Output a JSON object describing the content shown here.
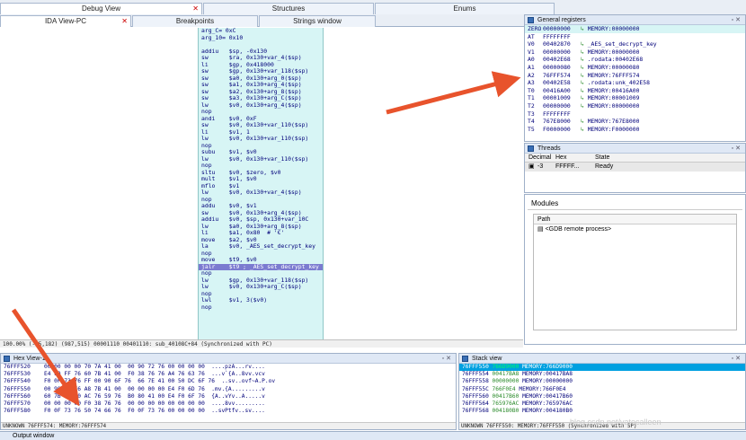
{
  "tabs": [
    {
      "label": "Debug View",
      "active": true
    },
    {
      "label": "Structures",
      "active": false
    },
    {
      "label": "Enums",
      "active": false
    },
    {
      "label": "IDA View-PC",
      "active": true
    },
    {
      "label": "Breakpoints",
      "active": false
    },
    {
      "label": "Strings window",
      "active": false
    }
  ],
  "disasm": [
    {
      "t": "arg_C= 0xC"
    },
    {
      "t": "arg_10= 0x10"
    },
    {
      "t": ""
    },
    {
      "t": "addiu   $sp, -0x130"
    },
    {
      "t": "sw      $ra, 0x130+var_4($sp)"
    },
    {
      "t": "li      $gp, 0x418000"
    },
    {
      "t": "sw      $gp, 0x130+var_118($sp)"
    },
    {
      "t": "sw      $a0, 0x130+arg_0($sp)"
    },
    {
      "t": "sw      $a1, 0x130+arg_4($sp)"
    },
    {
      "t": "sw      $a2, 0x130+arg_8($sp)"
    },
    {
      "t": "sw      $a3, 0x130+arg_C($sp)"
    },
    {
      "t": "lw      $v0, 0x130+arg_4($sp)"
    },
    {
      "t": "nop"
    },
    {
      "t": "andi    $v0, 0xF"
    },
    {
      "t": "sw      $v0, 0x130+var_110($sp)"
    },
    {
      "t": "li      $v1, 1"
    },
    {
      "t": "lw      $v0, 0x130+var_110($sp)"
    },
    {
      "t": "nop"
    },
    {
      "t": "subu    $v1, $v0"
    },
    {
      "t": "lw      $v0, 0x130+var_110($sp)"
    },
    {
      "t": "nop"
    },
    {
      "t": "sltu    $v0, $zero, $v0"
    },
    {
      "t": "mult    $v1, $v0"
    },
    {
      "t": "mflo    $v1"
    },
    {
      "t": "lw      $v0, 0x130+var_4($sp)"
    },
    {
      "t": "nop"
    },
    {
      "t": "addu    $v0, $v1"
    },
    {
      "t": "sw      $v0, 0x130+arg_4($sp)"
    },
    {
      "t": "addiu   $v0, $sp, 0x130+var_10C"
    },
    {
      "t": "lw      $a0, 0x130+arg_8($sp)"
    },
    {
      "t": "li      $a1, 0x80  # '€'"
    },
    {
      "t": "move    $a2, $v0"
    },
    {
      "t": "la      $v0, _AES_set_decrypt_key"
    },
    {
      "t": "nop"
    },
    {
      "t": "move    $t9, $v0"
    },
    {
      "t": "jalr    $t9 ; _AES_set_decrypt_key",
      "hl": true
    },
    {
      "t": "nop"
    },
    {
      "t": "lw      $gp, 0x130+var_118($sp)"
    },
    {
      "t": "lw      $v0, 0x130+arg_C($sp)"
    },
    {
      "t": "nop"
    },
    {
      "t": "lwl     $v1, 3($v0)"
    },
    {
      "t": "nop"
    }
  ],
  "status_line": "100.00% (-35,182) (987,515) 00001110 00401110: sub_40108C+84 (Synchronized with PC)",
  "registers": {
    "title": "General registers",
    "rows": [
      {
        "n": "ZERO",
        "v": "00000000",
        "c": "MEMORY:00000000",
        "sel": true
      },
      {
        "n": "AT",
        "v": "FFFFFFFF",
        "c": ""
      },
      {
        "n": "V0",
        "v": "00402870",
        "c": "_AES_set_decrypt_key"
      },
      {
        "n": "V1",
        "v": "00000000",
        "c": "MEMORY:00000000"
      },
      {
        "n": "A0",
        "v": "00402E68",
        "c": ".rodata:00402E68"
      },
      {
        "n": "A1",
        "v": "00000080",
        "c": "MEMORY:00000080"
      },
      {
        "n": "A2",
        "v": "76FFF574",
        "c": "MEMORY:76FFF574"
      },
      {
        "n": "A3",
        "v": "00402E58",
        "c": ".rodata:unk_402E58"
      },
      {
        "n": "T0",
        "v": "00416A00",
        "c": "MEMORY:00416A00"
      },
      {
        "n": "T1",
        "v": "00001009",
        "c": "MEMORY:00001009"
      },
      {
        "n": "T2",
        "v": "00000000",
        "c": "MEMORY:00000000"
      },
      {
        "n": "T3",
        "v": "FFFFFFFF",
        "c": ""
      },
      {
        "n": "T4",
        "v": "767E8000",
        "c": "MEMORY:767E8000"
      },
      {
        "n": "T5",
        "v": "F0000000",
        "c": "MEMORY:F0000000"
      }
    ]
  },
  "threads": {
    "title": "Threads",
    "columns": [
      "Decimal",
      "Hex",
      "State"
    ],
    "rows": [
      {
        "dec": "-3",
        "hex": "FFFFF...",
        "state": "Ready"
      }
    ]
  },
  "modules": {
    "title": "Modules",
    "column": "Path",
    "rows": [
      "<GDB remote process>"
    ]
  },
  "hex": {
    "title": "Hex View-1",
    "rows": [
      {
        "a": "76FFF520",
        "b": "00 00 00 00 70 7A 41 00  00 90 72 76 00 00 00 00",
        "s": "....pzA...rv...."
      },
      {
        "a": "76FFF530",
        "b": "E4 F0 FF 76 60 7B 41 00  F0 38 76 76 A4 76 63 76",
        "s": "...v`{A..8vv.vcv"
      },
      {
        "a": "76FFF540",
        "b": "F0 0F 73 76 FF 00 90 6F 76  66 7E 41 00 50 DC 6F 76",
        "s": "..sv..ovf~A.P.ov"
      },
      {
        "a": "76FFF550",
        "b": "00 90 6D 76 A8 7B 41 00  00 00 00 00 E4 F0 6D 76",
        "s": ".mv.{A.........v"
      },
      {
        "a": "76FFF560",
        "b": "60 7B 41 00 AC 76 59 76  B0 80 41 00 E4 F0 6F 76",
        "s": "{A..vYv..A.....v"
      },
      {
        "a": "76FFF570",
        "b": "00 00 00 00 F0 38 76 76  00 00 00 00 00 00 00 00",
        "s": "....8vv........."
      },
      {
        "a": "76FFF580",
        "b": "F0 0F 73 76 50 74 66 76  F0 0F 73 76 00 00 00 00",
        "s": "..svPtfv..sv...."
      }
    ],
    "status": "UNKNOWN 76FFF574: MEMORY:76FFF574"
  },
  "stack": {
    "title": "Stack view",
    "rows": [
      {
        "a": "76FFF550",
        "v": "766D9000",
        "c": "MEMORY:766D9000",
        "sel": true
      },
      {
        "a": "76FFF554",
        "v": "00417BA8",
        "c": "MEMORY:00417BA8"
      },
      {
        "a": "76FFF558",
        "v": "00000000",
        "c": "MEMORY:00000000"
      },
      {
        "a": "76FFF55C",
        "v": "766F0E4",
        "c": "MEMORY:766F0E4"
      },
      {
        "a": "76FFF560",
        "v": "00417B60",
        "c": "MEMORY:00417B60"
      },
      {
        "a": "76FFF564",
        "v": "765976AC",
        "c": "MEMORY:765976AC"
      },
      {
        "a": "76FFF568",
        "v": "004180B0",
        "c": "MEMORY:004180B0"
      }
    ],
    "status": "UNKNOWN 76FFF550: MEMORY:76FFF550 (Synchronized with SP)"
  },
  "output_title": "Output window",
  "watermark": "blog.csdn.net/yatecalleen",
  "colors": {
    "code_bg": "#d7f5f5",
    "highlight": "#ffff00",
    "arrow": "#e8532c"
  }
}
